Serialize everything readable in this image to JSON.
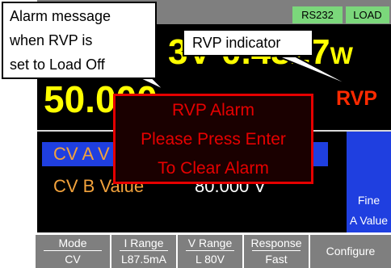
{
  "status": {
    "rs232": "RS232",
    "load": "LOAD"
  },
  "readings": {
    "top_value": "3V 0.4327",
    "top_unit": "W",
    "main_value": "50.000",
    "rvp": "RVP"
  },
  "rows": {
    "a_label": "CV A V",
    "b_label": "CV B Value",
    "b_value": "80.000 V"
  },
  "right_panel": {
    "line1": "Fine",
    "line2": "A Value"
  },
  "alarm": {
    "line1": "RVP Alarm",
    "line2": "Please Press Enter",
    "line3": "To Clear Alarm"
  },
  "callouts": {
    "alarm_message": [
      "Alarm message",
      "when RVP is",
      "set to Load Off"
    ],
    "rvp_indicator": "RVP indicator"
  },
  "softkeys": [
    {
      "top": "Mode",
      "bottom": "CV"
    },
    {
      "top": "I Range",
      "bottom": "L87.5mA"
    },
    {
      "top": "V Range",
      "bottom": "L 80V"
    },
    {
      "top": "Response",
      "bottom": "Fast"
    },
    {
      "label": "Configure"
    }
  ],
  "colors": {
    "background": "#000000",
    "statusbar": "#7f7f7f",
    "badge": "#7bd77b",
    "reading": "#ffff00",
    "alarm": "#e60000",
    "selection": "#1f3fe0",
    "row_text": "#f2a23c"
  }
}
